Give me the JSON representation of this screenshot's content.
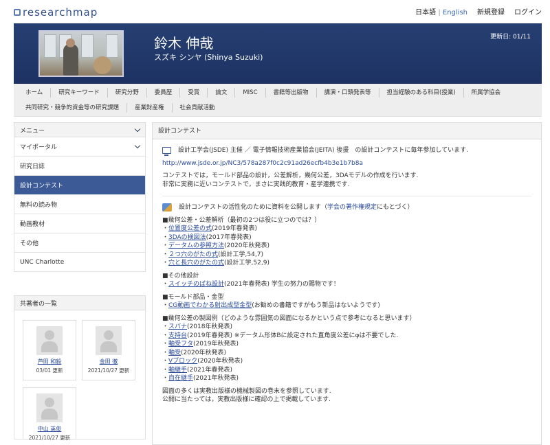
{
  "site": {
    "logo": "researchmap",
    "lang_ja": "日本語",
    "lang_sep": "|",
    "lang_en": "English",
    "register": "新規登録",
    "login": "ログイン"
  },
  "profile": {
    "name_jp": "鈴木 伸哉",
    "name_kana": "スズキ シンヤ  (Shinya Suzuki)",
    "updated": "更新日: 01/11"
  },
  "tabs_row1": [
    "ホーム",
    "研究キーワード",
    "研究分野",
    "委員歴",
    "受賞",
    "論文",
    "MISC",
    "書籍等出版物",
    "講演・口頭発表等",
    "担当経験のある科目(授業)",
    "所属学協会"
  ],
  "tabs_row2": [
    "共同研究・競争的資金等の研究課題",
    "産業財産権",
    "社会貢献活動"
  ],
  "sidebar": {
    "menu_title": "メニュー",
    "items": [
      {
        "label": "マイポータル",
        "chevron": true
      },
      {
        "label": "研究日誌",
        "chevron": false
      },
      {
        "label": "設計コンテスト",
        "chevron": false,
        "active": true
      },
      {
        "label": "無料の読み物",
        "chevron": false
      },
      {
        "label": "動画教材",
        "chevron": false
      },
      {
        "label": "その他",
        "chevron": false
      },
      {
        "label": "UNC Charlotte",
        "chevron": false
      }
    ],
    "coauthors_title": "共著者の一覧",
    "coauthors": [
      {
        "name": "芦田 和毅",
        "date": "03/01 更新"
      },
      {
        "name": "金田 徹",
        "date": "2021/10/27 更新"
      },
      {
        "name": "中山 英俊",
        "date": "2021/10/27 更新"
      }
    ]
  },
  "main": {
    "title": "設計コンテスト",
    "intro": "設計工学会(JSDE) 主催  ／  電子情報技術産業協会(JEITA) 後援　の設計コンテストに毎年参加しています.",
    "url": "http://www.jsde.or.jp/NC3/578a287f0c2c91ad26ecfb4b3e1b7b8a",
    "desc1": "コンテストでは，モールド部品の設計，公差解析，幾何公差，3DAモデルの作成を行います.",
    "desc2": "非常に実務に近いコンテストで，まさに実践的教育・産学連携です.",
    "pub_prefix": "設計コンテストの活性化のために資料を公開します（",
    "pub_link": "学会の著作権規定",
    "pub_suffix": "にもとづく）",
    "sec1_title": "■幾何公差・公差解析（最初の2つは役に立つのでは？）",
    "sec1_items": [
      {
        "link": "位置度公差の式",
        "rest": "(2019年春発表)"
      },
      {
        "link": "3DAの検図法",
        "rest": "(2017年春発表)"
      },
      {
        "link": "データムの参照方法",
        "rest": "(2020年秋発表)"
      },
      {
        "link": "２つ穴のがたの式",
        "rest": "(設計工学,54,7)"
      },
      {
        "link": "穴と長穴のがたの式",
        "rest": "(設計工学,52,9)"
      }
    ],
    "sec2_title": "■その他設計",
    "sec2_items": [
      {
        "link": "スイッチのばね設計",
        "rest": "(2021年春発表) 学生の努力の賜物です！"
      }
    ],
    "sec3_title": "■モールド部品・金型",
    "sec3_items": [
      {
        "link": "CG動画でわかる射出成型金型",
        "rest": "(お勧めの書籍ですがもう新品はないようです)"
      }
    ],
    "sec4_title": "■幾何公差の製図例（どのような雰囲気の図面になるかという点で参考になると思います）",
    "sec4_items": [
      {
        "link": "スパナ",
        "rest": "(2018年秋発表)"
      },
      {
        "link": "支持台",
        "rest": "(2019年春発表) ※データム形体Bに設定された直角度公差にφは不要でした."
      },
      {
        "link": "軸受フタ",
        "rest": "(2019年秋発表)"
      },
      {
        "link": "軸受",
        "rest": "(2020年秋発表)"
      },
      {
        "link": "Vブロック",
        "rest": "(2020年秋発表)"
      },
      {
        "link": "軸継手",
        "rest": "(2021年春発表)"
      },
      {
        "link": "自在継手",
        "rest": "(2021年秋発表)"
      }
    ],
    "note1": "図面の多くは実教出版様の機械製図の巻末を参照しています.",
    "note2": "公開に当たっては，実教出版様に確認の上で掲載しています."
  }
}
